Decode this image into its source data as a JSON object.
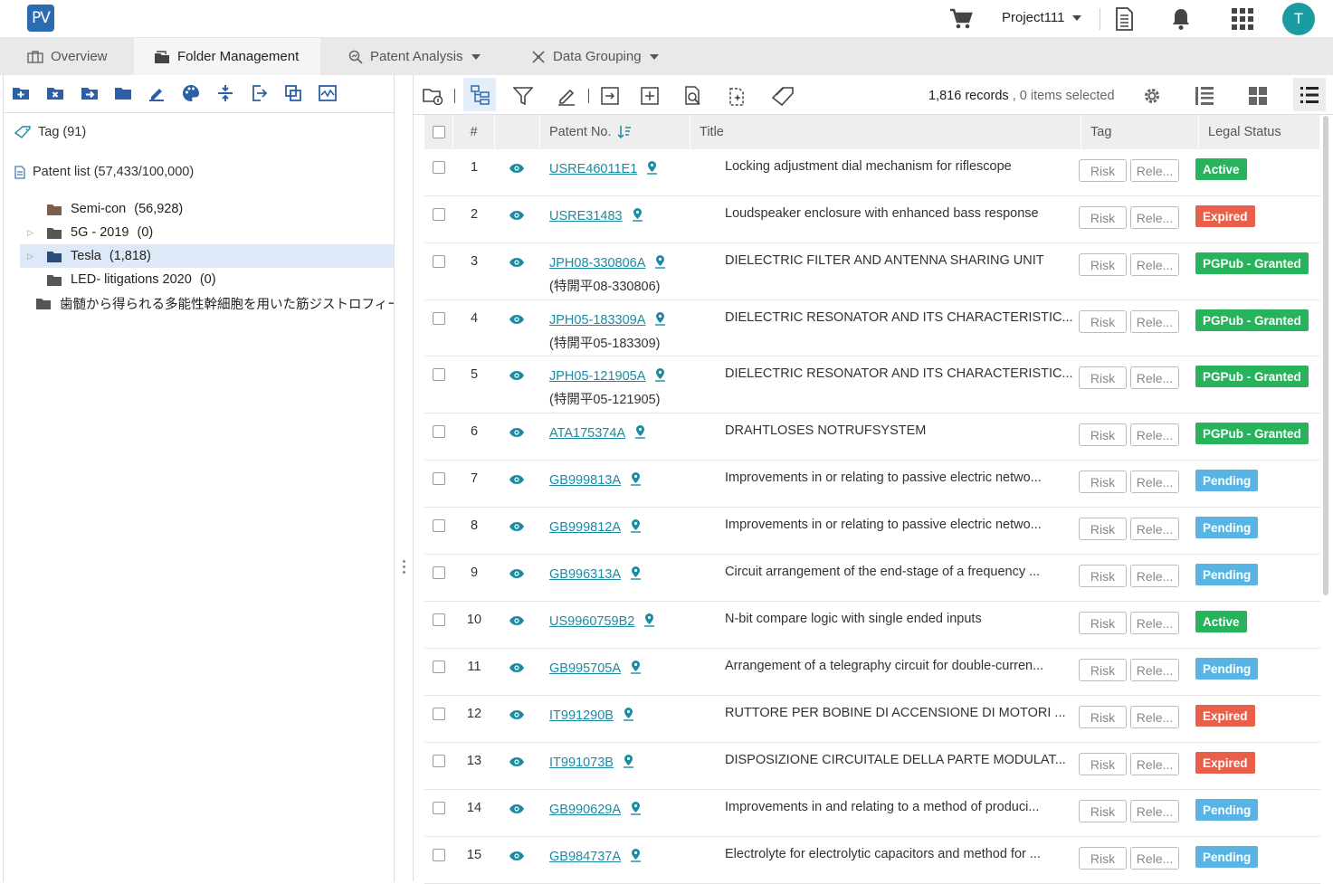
{
  "app": {
    "logo_text": "PV",
    "project": "Project111",
    "user_initial": "T",
    "avatar_color": "#1a9ba1"
  },
  "tabs": [
    {
      "label": "Overview",
      "icon": "overview-icon"
    },
    {
      "label": "Folder Management",
      "icon": "folder-manage-icon"
    },
    {
      "label": "Patent Analysis",
      "icon": "analysis-icon"
    },
    {
      "label": "Data Grouping",
      "icon": "grouping-icon"
    }
  ],
  "left": {
    "tag_label": "Tag (91)",
    "patent_list_label": "Patent list (57,433/100,000)",
    "folders": [
      {
        "name": "Semi-con",
        "count": "(56,928)",
        "color": "#7b5e4a",
        "expandable": false,
        "selected": false
      },
      {
        "name": "5G - 2019",
        "count": "(0)",
        "color": "#555",
        "expandable": true,
        "selected": false
      },
      {
        "name": "Tesla",
        "count": "(1,818)",
        "color": "#2c4a7a",
        "expandable": true,
        "selected": true
      },
      {
        "name": "LED- litigations 2020",
        "count": "(0)",
        "color": "#555",
        "expandable": false,
        "selected": false
      },
      {
        "name": "歯髄から得られる多能性幹細胞を用いた筋ジストロフィー",
        "count": "",
        "color": "#555",
        "expandable": false,
        "selected": false
      }
    ]
  },
  "toolbar": {
    "records": "1,816 records",
    "selected": "0 items selected"
  },
  "table": {
    "headers": {
      "num": "#",
      "patent": "Patent No.",
      "title": "Title",
      "tag": "Tag",
      "status": "Legal Status"
    },
    "tag_labels": {
      "risk": "Risk",
      "rele": "Rele..."
    },
    "status_colors": {
      "Active": "#27b35b",
      "Expired": "#e8604a",
      "PGPub - Granted": "#27b35b",
      "Pending": "#58b4e5"
    },
    "rows": [
      {
        "n": "1",
        "pn": "USRE46011E1",
        "sub": "",
        "title": "Locking adjustment dial mechanism for riflescope",
        "status": "Active"
      },
      {
        "n": "2",
        "pn": "USRE31483",
        "sub": "",
        "title": "Loudspeaker enclosure with enhanced bass response",
        "status": "Expired"
      },
      {
        "n": "3",
        "pn": "JPH08-330806A",
        "sub": "(特開平08-330806)",
        "title": "DIELECTRIC FILTER AND ANTENNA SHARING UNIT",
        "status": "PGPub - Granted"
      },
      {
        "n": "4",
        "pn": "JPH05-183309A",
        "sub": "(特開平05-183309)",
        "title": "DIELECTRIC RESONATOR AND ITS CHARACTERISTIC...",
        "status": "PGPub - Granted"
      },
      {
        "n": "5",
        "pn": "JPH05-121905A",
        "sub": "(特開平05-121905)",
        "title": "DIELECTRIC RESONATOR AND ITS CHARACTERISTIC...",
        "status": "PGPub - Granted"
      },
      {
        "n": "6",
        "pn": "ATA175374A",
        "sub": "",
        "title": "DRAHTLOSES NOTRUFSYSTEM",
        "status": "PGPub - Granted"
      },
      {
        "n": "7",
        "pn": "GB999813A",
        "sub": "",
        "title": "Improvements in or relating to passive electric netwo...",
        "status": "Pending"
      },
      {
        "n": "8",
        "pn": "GB999812A",
        "sub": "",
        "title": "Improvements in or relating to passive electric netwo...",
        "status": "Pending"
      },
      {
        "n": "9",
        "pn": "GB996313A",
        "sub": "",
        "title": "Circuit arrangement of the end-stage of a frequency ...",
        "status": "Pending"
      },
      {
        "n": "10",
        "pn": "US9960759B2",
        "sub": "",
        "title": "N-bit compare logic with single ended inputs",
        "status": "Active"
      },
      {
        "n": "11",
        "pn": "GB995705A",
        "sub": "",
        "title": "Arrangement of a telegraphy circuit for double-curren...",
        "status": "Pending"
      },
      {
        "n": "12",
        "pn": "IT991290B",
        "sub": "",
        "title": "RUTTORE PER BOBINE DI ACCENSIONE DI MOTORI ...",
        "status": "Expired"
      },
      {
        "n": "13",
        "pn": "IT991073B",
        "sub": "",
        "title": "DISPOSIZIONE CIRCUITALE DELLA PARTE MODULAT...",
        "status": "Expired"
      },
      {
        "n": "14",
        "pn": "GB990629A",
        "sub": "",
        "title": "Improvements in and relating to a method of produci...",
        "status": "Pending"
      },
      {
        "n": "15",
        "pn": "GB984737A",
        "sub": "",
        "title": "Electrolyte for electrolytic capacitors and method for ...",
        "status": "Pending"
      }
    ]
  }
}
